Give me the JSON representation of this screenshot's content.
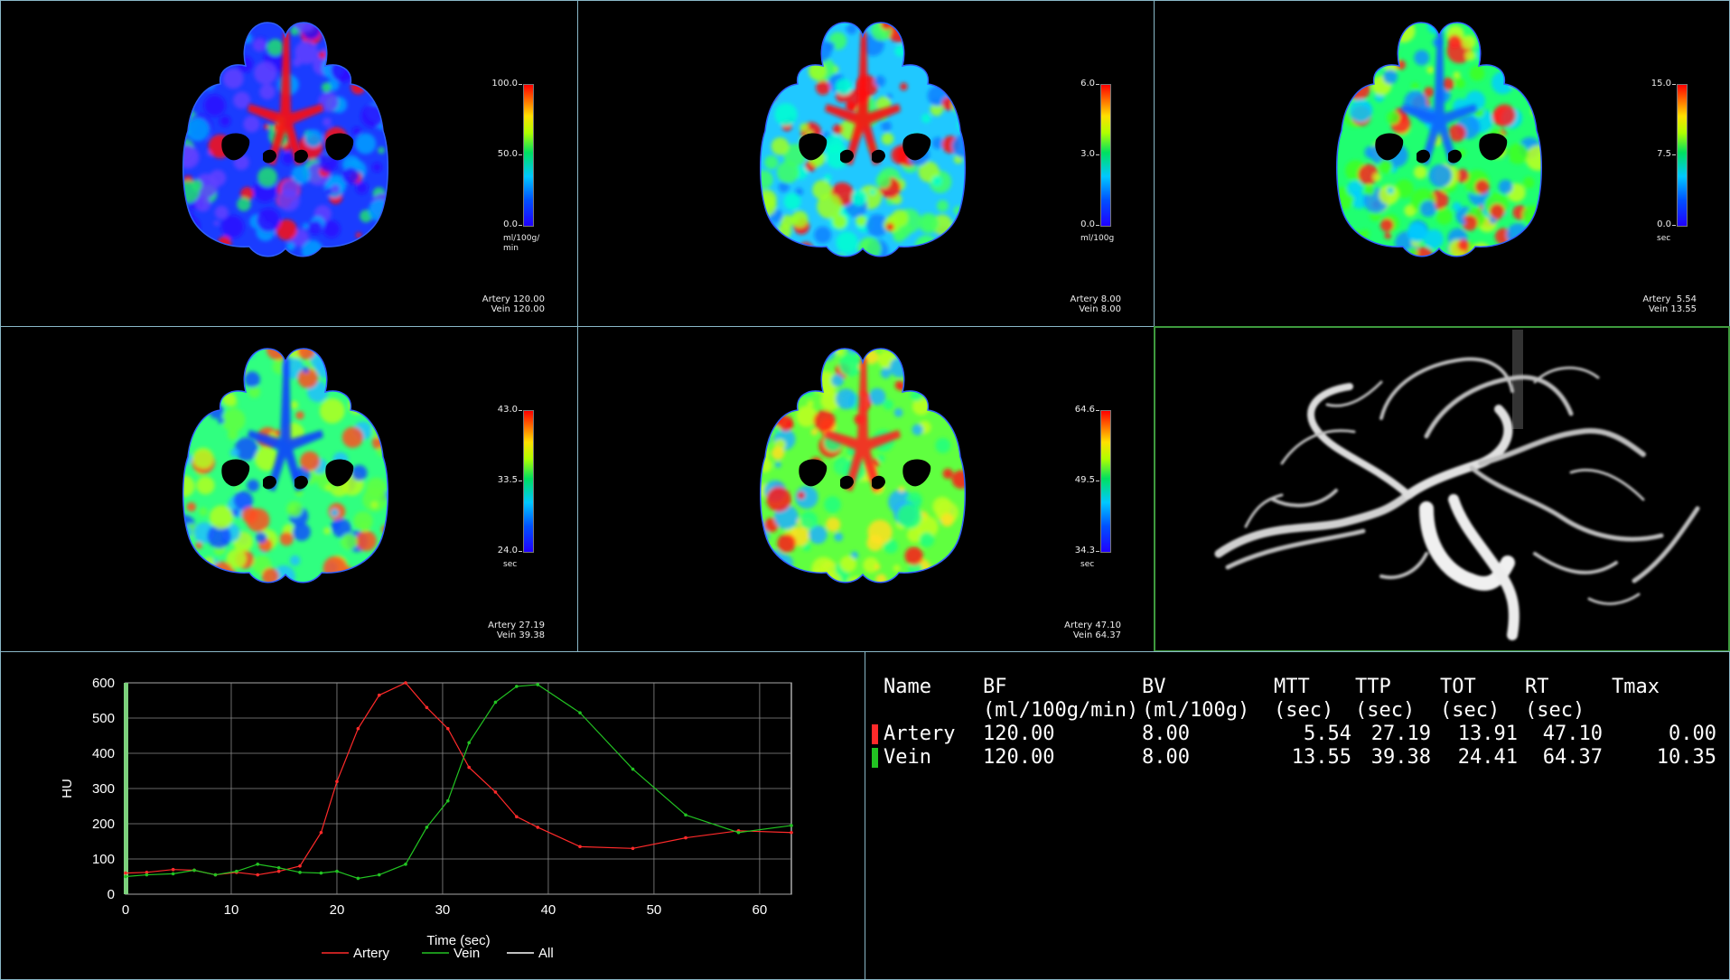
{
  "maps": [
    {
      "scale_max": "100.0",
      "scale_mid": "50.0",
      "scale_min": "0.0",
      "unit_line1": "ml/100g/",
      "unit_line2": "min",
      "artery": "Artery 120.00",
      "vein": "Vein 120.00"
    },
    {
      "scale_max": "6.0",
      "scale_mid": "3.0",
      "scale_min": "0.0",
      "unit_line1": "ml/100g",
      "unit_line2": "",
      "artery": "Artery 8.00",
      "vein": "Vein 8.00"
    },
    {
      "scale_max": "15.0",
      "scale_mid": "7.5",
      "scale_min": "0.0",
      "unit_line1": "sec",
      "unit_line2": "",
      "artery": "Artery  5.54",
      "vein": "Vein 13.55"
    },
    {
      "scale_max": "43.0",
      "scale_mid": "33.5",
      "scale_min": "24.0",
      "unit_line1": "sec",
      "unit_line2": "",
      "artery": "Artery 27.19",
      "vein": "Vein 39.38"
    },
    {
      "scale_max": "64.6",
      "scale_mid": "49.5",
      "scale_min": "34.3",
      "unit_line1": "sec",
      "unit_line2": "",
      "artery": "Artery 47.10",
      "vein": "Vein 64.37"
    }
  ],
  "chart_data": {
    "type": "line",
    "xlabel": "Time (sec)",
    "ylabel": "HU",
    "xlim": [
      0,
      63
    ],
    "ylim": [
      0,
      600
    ],
    "xticks": [
      0,
      10,
      20,
      30,
      40,
      50,
      60
    ],
    "yticks": [
      0,
      100,
      200,
      300,
      400,
      500,
      600
    ],
    "grid": true,
    "legend": [
      {
        "name": "Artery",
        "color": "#ff2a2a"
      },
      {
        "name": "Vein",
        "color": "#22c322"
      },
      {
        "name": "All",
        "color": "#ffffff"
      }
    ],
    "series": [
      {
        "name": "Artery",
        "color": "#ff2a2a",
        "x": [
          0,
          2,
          4.5,
          6.5,
          8.5,
          10.5,
          12.5,
          14.5,
          16.5,
          18.5,
          20,
          22,
          24,
          26.5,
          28.5,
          30.5,
          32.5,
          35,
          37,
          39,
          43,
          48,
          53,
          58,
          63
        ],
        "y": [
          60,
          62,
          70,
          68,
          55,
          62,
          55,
          65,
          80,
          175,
          320,
          470,
          565,
          600,
          530,
          470,
          360,
          290,
          220,
          190,
          135,
          130,
          160,
          180,
          175
        ]
      },
      {
        "name": "Vein",
        "color": "#22c322",
        "x": [
          0,
          2,
          4.5,
          6.5,
          8.5,
          10.5,
          12.5,
          14.5,
          16.5,
          18.5,
          20,
          22,
          24,
          26.5,
          28.5,
          30.5,
          32.5,
          35,
          37,
          39,
          43,
          48,
          53,
          58,
          63
        ],
        "y": [
          50,
          55,
          58,
          68,
          55,
          65,
          85,
          75,
          62,
          60,
          65,
          45,
          55,
          85,
          190,
          265,
          430,
          545,
          590,
          595,
          515,
          355,
          225,
          175,
          195
        ]
      }
    ]
  },
  "table": {
    "headers": [
      "Name",
      "BF",
      "BV",
      "MTT",
      "TTP",
      "TOT",
      "RT",
      "Tmax"
    ],
    "units": [
      "",
      "(ml/100g/min)",
      "(ml/100g)",
      "(sec)",
      "(sec)",
      "(sec)",
      "(sec)",
      ""
    ],
    "rows": [
      {
        "name": "Artery",
        "color": "#ff2a2a",
        "values": [
          "120.00",
          "8.00",
          "5.54",
          "27.19",
          "13.91",
          "47.10",
          "0.00"
        ]
      },
      {
        "name": "Vein",
        "color": "#22c322",
        "values": [
          "120.00",
          "8.00",
          "13.55",
          "39.38",
          "24.41",
          "64.37",
          "10.35"
        ]
      }
    ]
  }
}
